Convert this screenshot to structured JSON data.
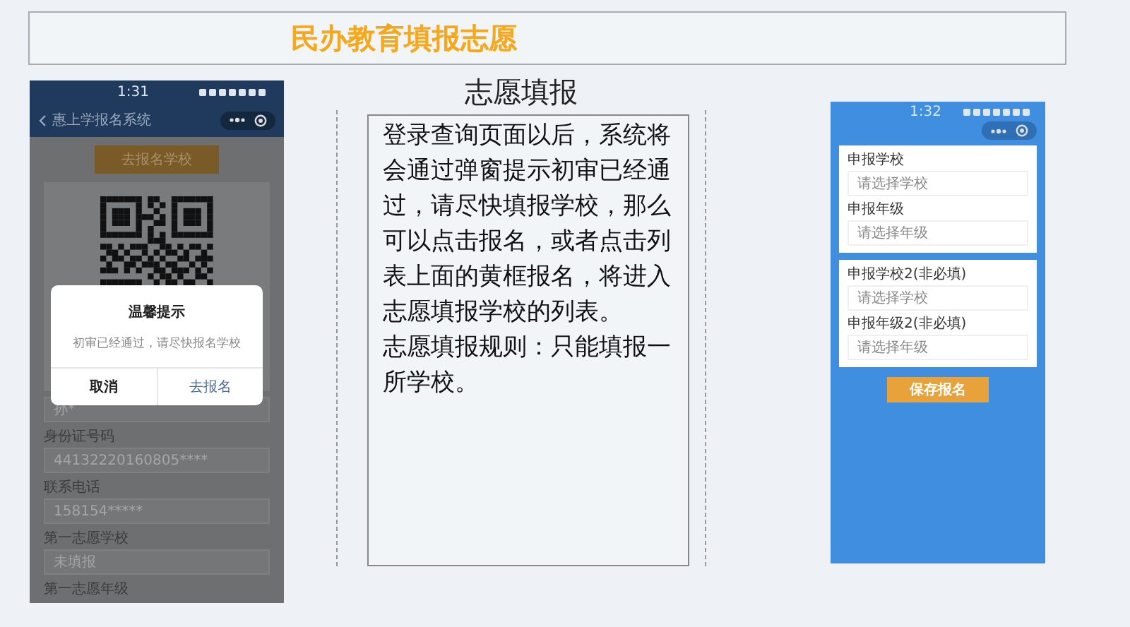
{
  "title": "民办教育填报志愿",
  "left_phone": {
    "status_time": "1:31",
    "nav_title": "惠上学报名系统",
    "top_button": "去报名学校",
    "fields": [
      {
        "value": "孙*"
      },
      {
        "label": "身份证号码",
        "value": "44132220160805****"
      },
      {
        "label": "联系电话",
        "value": "158154*****"
      },
      {
        "label": "第一志愿学校",
        "value": "未填报"
      },
      {
        "label": "第一志愿年级"
      }
    ],
    "dialog": {
      "title": "温馨提示",
      "message": "初审已经通过，请尽快报名学校",
      "buttons": [
        {
          "label": "取消",
          "kind": "cancel"
        },
        {
          "label": "去报名",
          "kind": "confirm"
        }
      ]
    }
  },
  "middle": {
    "heading": "志愿填报",
    "paragraphs": [
      "登录查询页面以后，系统将会通过弹窗提示初审已经通过，请尽快填报学校，那么可以点击报名，或者点击列表上面的黄框报名，将进入志愿填报学校的列表。",
      "志愿填报规则：只能填报一所学校。"
    ]
  },
  "right_phone": {
    "status_time": "1:32",
    "cards": [
      [
        {
          "label": "申报学校",
          "placeholder": "请选择学校"
        },
        {
          "label": "申报年级",
          "placeholder": "请选择年级"
        }
      ],
      [
        {
          "label": "申报学校2(非必填)",
          "placeholder": "请选择学校"
        },
        {
          "label": "申报年级2(非必填)",
          "placeholder": "请选择年级"
        }
      ]
    ],
    "save_button": "保存报名"
  }
}
